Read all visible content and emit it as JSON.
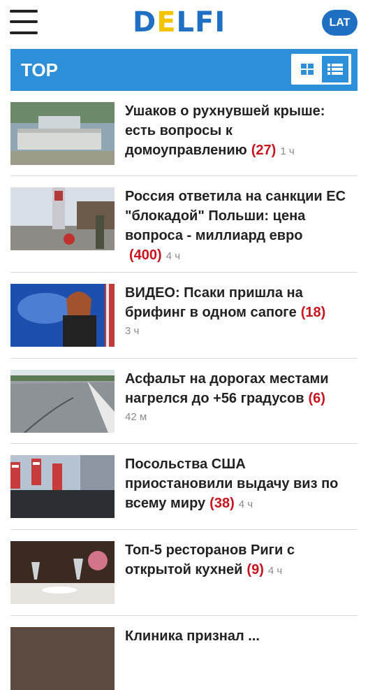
{
  "header": {
    "logo_text_d": "D",
    "logo_text_e": "E",
    "logo_text_rest": "LFI",
    "lang_button": "LAT"
  },
  "section": {
    "title": "TOP",
    "view_toggle": [
      "grid-view-icon",
      "list-view-icon"
    ]
  },
  "articles": [
    {
      "title": "Ушаков о рухнувшей крыше: есть вопросы к домоуправлению",
      "comments": "(27)",
      "time": "1 ч"
    },
    {
      "title": "Россия ответила на санкции ЕС \"блокадой\" Польши: цена вопроса - миллиард евро",
      "comments": "(400)",
      "time": "4 ч"
    },
    {
      "title": "ВИДЕО: Псаки пришла на брифинг в одном сапоге",
      "comments": "(18)",
      "time": "3 ч"
    },
    {
      "title": "Асфальт на дорогах местами нагрелся до +56 градусов",
      "comments": "(6)",
      "time": "42 м"
    },
    {
      "title": "Посольства США приостановили выдачу виз по всему миру",
      "comments": "(38)",
      "time": "4 ч"
    },
    {
      "title": "Топ-5 ресторанов Риги с открытой кухней",
      "comments": "(9)",
      "time": "4 ч"
    },
    {
      "title": "Клиника признал ...",
      "comments": "",
      "time": ""
    }
  ],
  "colors": {
    "brand_blue": "#1f6fc2",
    "brand_yellow": "#f4c400",
    "bar_blue": "#2d8fd8",
    "comment_red": "#c8141e"
  }
}
